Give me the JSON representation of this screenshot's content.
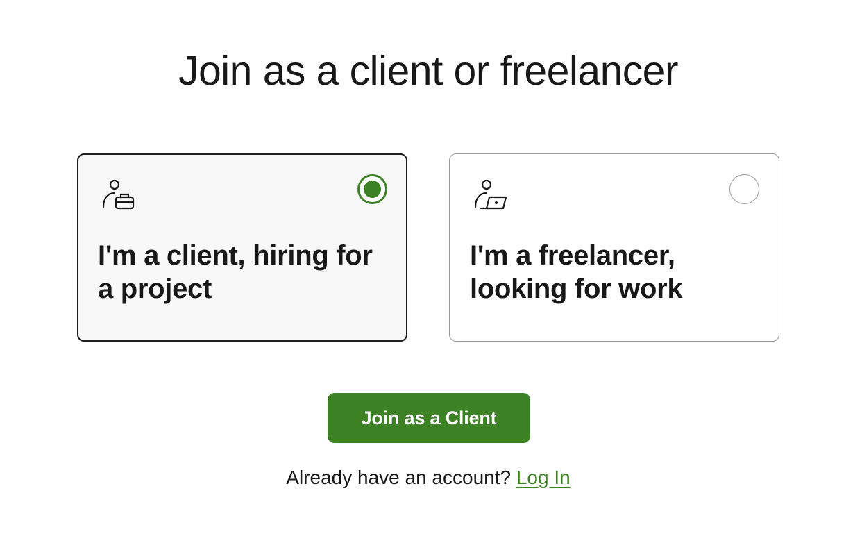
{
  "page": {
    "title": "Join as a client or freelancer"
  },
  "options": [
    {
      "id": "client",
      "label": "I'm a client, hiring for a project",
      "icon": "person-briefcase-icon",
      "selected": true
    },
    {
      "id": "freelancer",
      "label": "I'm a freelancer, looking for work",
      "icon": "person-laptop-icon",
      "selected": false
    }
  ],
  "primary_button": {
    "label": "Join as a Client"
  },
  "login": {
    "prompt": "Already have an account?",
    "link_label": "Log In"
  },
  "colors": {
    "accent": "#3c8224",
    "text": "#181818",
    "selected_card_bg": "#f8f8f8",
    "selected_border": "#1f1f1f",
    "unselected_border": "#9b9b9b"
  }
}
